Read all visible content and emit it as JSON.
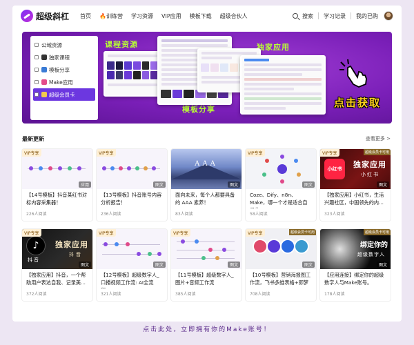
{
  "header": {
    "logo_text": "超级斜杠",
    "nav": [
      {
        "label": "首页"
      },
      {
        "label": "训练营",
        "fire": "🔥"
      },
      {
        "label": "学习资源"
      },
      {
        "label": "VIP应用"
      },
      {
        "label": "模板下载"
      },
      {
        "label": "超级合伙人"
      }
    ],
    "search_label": "搜索",
    "study_record": "学习记录",
    "my_purchases": "我的已购"
  },
  "banner": {
    "menu": [
      {
        "label": "公域资源"
      },
      {
        "label": "独家课程"
      },
      {
        "label": "模板分享"
      },
      {
        "label": "Make应用"
      },
      {
        "label": "超级会员卡"
      }
    ],
    "label_courses": "课程资源",
    "label_apps": "独家应用",
    "label_templates": "模板分享",
    "cta": "点击获取"
  },
  "section": {
    "title": "最新更新",
    "see_more": "查看更多 >"
  },
  "cards": [
    {
      "vip": "VIP专享",
      "tag": "应用",
      "title": "【14号模板】抖音某红书对标内容采集器！",
      "meta": "226人阅读"
    },
    {
      "vip": "VIP专享",
      "tag": "图文",
      "title": "【13号模板】抖音账号内容分析报告！",
      "meta": "236人阅读"
    },
    {
      "vip": "",
      "tag": "图文",
      "title": "面向未来，每个人都要具备的 AAA 素养！",
      "meta": "83人阅读",
      "thumb_text": "AAA"
    },
    {
      "vip": "VIP专享",
      "tag": "图文",
      "title": "Coze、Dify、n8n、Make，哪一个才是适合自己的AI...",
      "meta": "58人阅读"
    },
    {
      "vip": "VIP专享",
      "vip_right": "超级会员卡可用",
      "tag": "图文",
      "title": "【独家应用】小红书，生活兴趣社区，中国领先的内...",
      "meta": "323人阅读",
      "thumb_big": "独家应用",
      "thumb_small": "小红书",
      "logo": "小红书"
    },
    {
      "vip": "VIP专享",
      "tag": "图文",
      "title": "【独家应用】抖音，一个帮助用户表达自我、记录美...",
      "meta": "372人阅读",
      "thumb_big": "独家应用",
      "thumb_small": "抖音",
      "logo_label": "抖音"
    },
    {
      "vip": "VIP专享",
      "tag": "图文",
      "title": "【12号模板】超级数字人_口播视频工作流: AI全流程...",
      "meta": "321人阅读"
    },
    {
      "vip": "VIP专享",
      "tag": "图文",
      "title": "【11号模板】超级数字人_图片+音频工作流",
      "meta": "385人阅读"
    },
    {
      "vip": "VIP专享",
      "vip_right": "超级会员卡可用",
      "tag": "图文",
      "title": "【10号模板】营销海报图工作流，飞书多维表格+即梦AI",
      "meta": "708人阅读"
    },
    {
      "vip": "",
      "vip_right": "超级会员卡可用",
      "tag": "图文",
      "title": "【应用连接】绑定你的超级数字人与Make账号。",
      "meta": "178人阅读",
      "thumb_big": "绑定你的",
      "thumb_small": "超级数字人"
    }
  ],
  "bottom_cta": "点击此处，立即拥有你的Make账号！",
  "colors": {
    "accent": "#6c37e0",
    "banner": "#7a1fb8",
    "label_green": "#b8ff34",
    "cta_yellow": "#ffd21e"
  }
}
